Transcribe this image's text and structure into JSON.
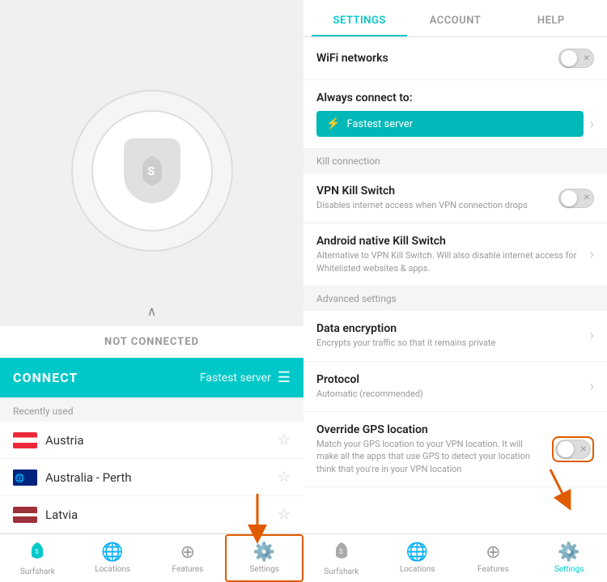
{
  "left_panel": {
    "status": "NOT CONNECTED",
    "connect_button": "CONNECT",
    "fastest_server": "Fastest server",
    "recently_used": "Recently used",
    "locations": [
      {
        "name": "Austria",
        "flag": "austria"
      },
      {
        "name": "Australia - Perth",
        "flag": "australia"
      },
      {
        "name": "Latvia",
        "flag": "latvia"
      }
    ],
    "bottom_nav": [
      {
        "id": "surfshark",
        "label": "Surfshark",
        "icon": "🦈"
      },
      {
        "id": "locations",
        "label": "Locations",
        "icon": "🌐"
      },
      {
        "id": "features",
        "label": "Features",
        "icon": "➕"
      },
      {
        "id": "settings",
        "label": "Settings",
        "icon": "⚙️",
        "highlighted": true
      }
    ]
  },
  "right_panel": {
    "tabs": [
      {
        "id": "settings",
        "label": "SETTINGS",
        "active": true
      },
      {
        "id": "account",
        "label": "ACCOUNT",
        "active": false
      },
      {
        "id": "help",
        "label": "HELP",
        "active": false
      }
    ],
    "settings": [
      {
        "type": "row",
        "title": "WiFi networks",
        "toggle": true,
        "toggle_state": "off"
      },
      {
        "type": "always_connect",
        "label": "Always connect to:",
        "server": "Fastest server"
      },
      {
        "type": "section",
        "label": "Kill connection"
      },
      {
        "type": "row",
        "title": "VPN Kill Switch",
        "subtitle": "Disables internet access when VPN connection drops",
        "toggle": true,
        "toggle_state": "off"
      },
      {
        "type": "row",
        "title": "Android native Kill Switch",
        "subtitle": "Alternative to VPN Kill Switch. Will also disable internet access for Whitelisted websites & apps.",
        "chevron": true
      },
      {
        "type": "section",
        "label": "Advanced settings"
      },
      {
        "type": "row",
        "title": "Data encryption",
        "subtitle": "Encrypts your traffic so that it remains private",
        "chevron": true
      },
      {
        "type": "row",
        "title": "Protocol",
        "subtitle": "Automatic (recommended)",
        "chevron": true
      },
      {
        "type": "row",
        "title": "Override GPS location",
        "subtitle": "Match your GPS location to your VPN location. It will make all the apps that use GPS to detect your location think that you're in your VPN location",
        "toggle": true,
        "toggle_state": "off",
        "highlighted": true
      }
    ],
    "bottom_nav": [
      {
        "id": "surfshark",
        "label": "Surfshark",
        "icon": "🦈"
      },
      {
        "id": "locations",
        "label": "Locations",
        "icon": "🌐"
      },
      {
        "id": "features",
        "label": "Features",
        "icon": "➕"
      },
      {
        "id": "settings",
        "label": "Settings",
        "icon": "⚙️",
        "active": true
      }
    ]
  }
}
